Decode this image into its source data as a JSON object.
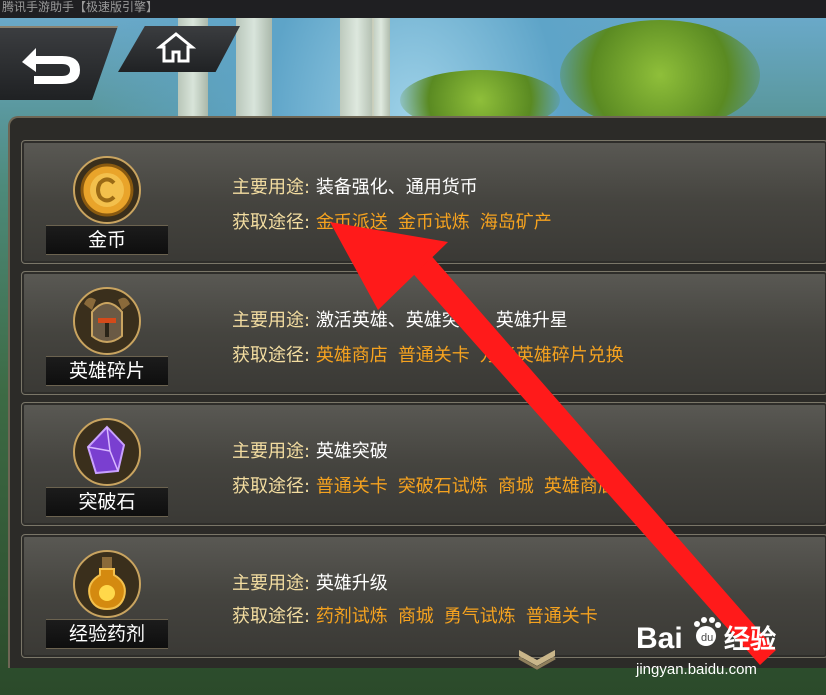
{
  "window_title": "腾讯手游助手【极速版引擎】",
  "nav": {
    "back_icon": "back-arrow-icon",
    "home_icon": "home-icon"
  },
  "labels": {
    "usage": "主要用途",
    "obtain": "获取途径",
    "colon": ":"
  },
  "items": [
    {
      "name": "金币",
      "icon": "gold-coin-icon",
      "usage": "装备强化、通用货币",
      "sources": [
        "金币派送",
        "金币试炼",
        "海岛矿产"
      ]
    },
    {
      "name": "英雄碎片",
      "icon": "hero-helmet-icon",
      "usage": "激活英雄、英雄突破、英雄升星",
      "sources": [
        "英雄商店",
        "普通关卡",
        "万能英雄碎片兑换"
      ]
    },
    {
      "name": "突破石",
      "icon": "purple-crystal-icon",
      "usage": "英雄突破",
      "sources": [
        "普通关卡",
        "突破石试炼",
        "商城",
        "英雄商店"
      ]
    },
    {
      "name": "经验药剂",
      "icon": "exp-potion-icon",
      "usage": "英雄升级",
      "sources": [
        "药剂试炼",
        "商城",
        "勇气试炼",
        "普通关卡"
      ]
    }
  ],
  "watermark": {
    "brand": "Bai",
    "brand2": "经验",
    "url": "jingyan.baidu.com"
  },
  "colors": {
    "label": "#f2dca0",
    "source": "#f5a21f",
    "arrow": "#ff1a1a"
  }
}
